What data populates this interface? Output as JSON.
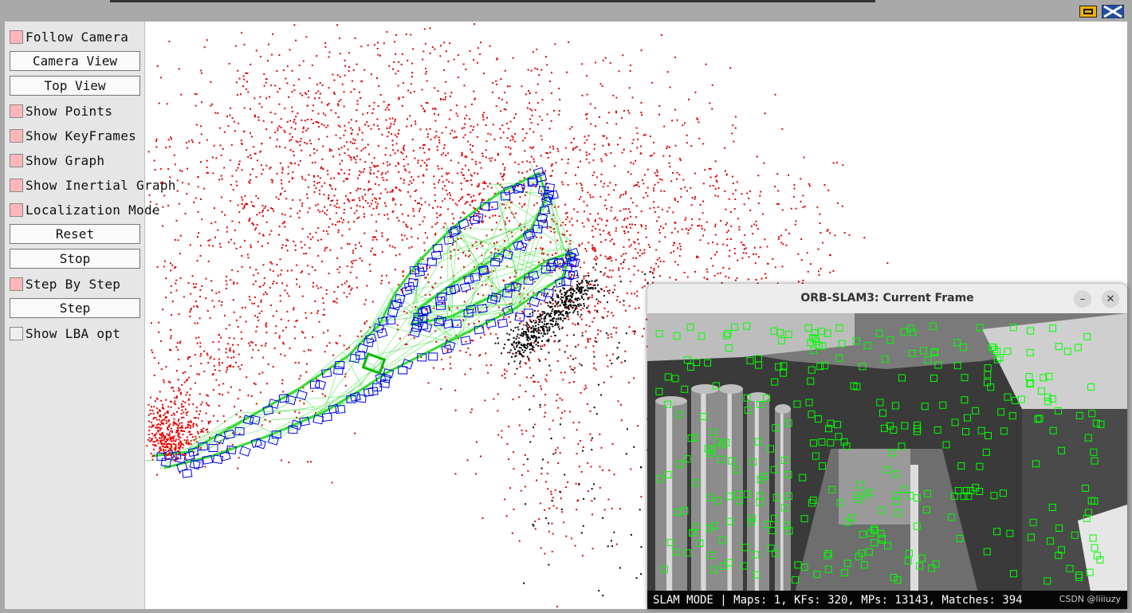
{
  "window": {
    "controls": [
      {
        "name": "minimize",
        "icon": "minimize-icon"
      },
      {
        "name": "close",
        "icon": "close-icon"
      }
    ]
  },
  "panel": {
    "follow_camera": {
      "label": "Follow Camera",
      "checked": true
    },
    "camera_view": "Camera View",
    "top_view": "Top View",
    "show_points": {
      "label": "Show Points",
      "checked": true
    },
    "show_keyframes": {
      "label": "Show KeyFrames",
      "checked": true
    },
    "show_graph": {
      "label": "Show Graph",
      "checked": true
    },
    "show_inertial_graph": {
      "label": "Show Inertial Graph",
      "checked": true
    },
    "localization_mode": {
      "label": "Localization Mode",
      "checked": true
    },
    "reset": "Reset",
    "stop": "Stop",
    "step_by_step": {
      "label": "Step By Step",
      "checked": true
    },
    "step": "Step",
    "show_lba_opt": {
      "label": "Show LBA opt",
      "checked": false
    }
  },
  "map_view": {
    "colors": {
      "map_points": "#e00000",
      "local_points": "#000000",
      "keyframes": "#0000ee",
      "graph": "#33dd33",
      "current_camera": "#00bb00",
      "reference_points": "#ff0000"
    }
  },
  "current_frame": {
    "title": "ORB-SLAM3: Current Frame",
    "status_text": "SLAM MODE |  Maps: 1, KFs: 320, MPs: 13143, Matches: 394",
    "watermark": "CSDN @liiiuzy",
    "feature_color": "#00ff00"
  }
}
